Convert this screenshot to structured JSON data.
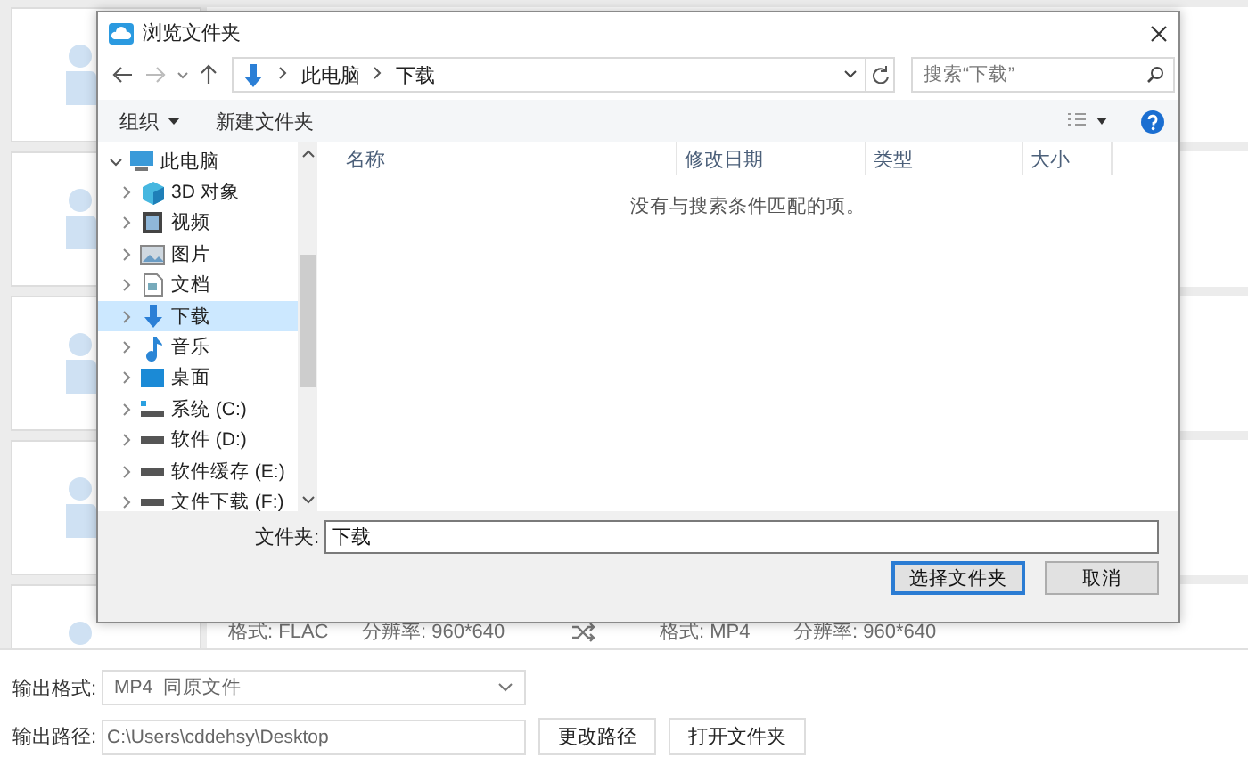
{
  "background": {
    "details": [
      {
        "format": "格式: FLAC",
        "resolution": "分辨率: 960*640"
      },
      {
        "format": "格式: MP4",
        "resolution": "分辨率: 960*640"
      }
    ]
  },
  "dialog": {
    "title": "浏览文件夹",
    "address": {
      "segments": [
        "此电脑",
        "下载"
      ]
    },
    "search": {
      "placeholder": "搜索“下载”"
    },
    "toolbar": {
      "organize": "组织",
      "new_folder": "新建文件夹"
    },
    "nav": {
      "items": [
        {
          "label": "此电脑",
          "kind": "pc",
          "expanded": true,
          "selected": false,
          "children": [
            {
              "label": "3D 对象",
              "kind": "cube",
              "expanded": false,
              "selected": false
            },
            {
              "label": "视频",
              "kind": "video",
              "expanded": false,
              "selected": false
            },
            {
              "label": "图片",
              "kind": "pictures",
              "expanded": false,
              "selected": false
            },
            {
              "label": "文档",
              "kind": "documents",
              "expanded": false,
              "selected": false
            },
            {
              "label": "下载",
              "kind": "downloads",
              "expanded": false,
              "selected": true
            },
            {
              "label": "音乐",
              "kind": "music",
              "expanded": false,
              "selected": false
            },
            {
              "label": "桌面",
              "kind": "desktop",
              "expanded": false,
              "selected": false
            },
            {
              "label": "系统 (C:)",
              "kind": "system-drive",
              "expanded": false,
              "selected": false
            },
            {
              "label": "软件 (D:)",
              "kind": "drive",
              "expanded": false,
              "selected": false
            },
            {
              "label": "软件缓存 (E:)",
              "kind": "drive",
              "expanded": false,
              "selected": false
            },
            {
              "label": "文件下载 (F:)",
              "kind": "drive",
              "expanded": false,
              "selected": false
            }
          ]
        }
      ]
    },
    "columns": [
      "名称",
      "修改日期",
      "类型",
      "大小"
    ],
    "empty_message": "没有与搜索条件匹配的项。",
    "folder": {
      "label": "文件夹:",
      "value": "下载"
    },
    "buttons": [
      {
        "label": "选择文件夹",
        "default": true
      },
      {
        "label": "取消",
        "default": false
      }
    ]
  },
  "output": {
    "format": {
      "label": "输出格式:",
      "value": "MP4  同原文件"
    },
    "path": {
      "label": "输出路径:",
      "value": "C:\\Users\\cddehsy\\Desktop"
    },
    "buttons": [
      "更改路径",
      "打开文件夹"
    ]
  }
}
